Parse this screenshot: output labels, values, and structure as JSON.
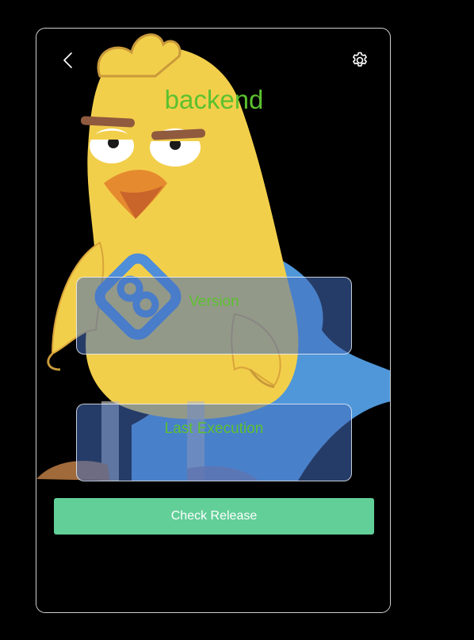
{
  "header": {
    "back_icon": "chevron-left-icon",
    "settings_icon": "gear-icon",
    "title": "backend"
  },
  "cards": {
    "version_label": "Version",
    "last_execution_label": "Last Execution"
  },
  "actions": {
    "check_release_label": "Check Release"
  },
  "colors": {
    "accent_text": "#5cc12f",
    "button_bg": "#62cf98",
    "background": "#000000",
    "card_bg": "#466ebe"
  }
}
